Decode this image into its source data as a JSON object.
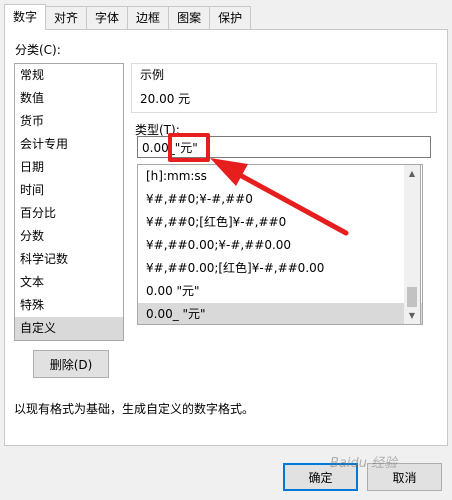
{
  "tabs": [
    {
      "label": "数字"
    },
    {
      "label": "对齐"
    },
    {
      "label": "字体"
    },
    {
      "label": "边框"
    },
    {
      "label": "图案"
    },
    {
      "label": "保护"
    }
  ],
  "category": {
    "label": "分类(C):",
    "items": [
      {
        "label": "常规"
      },
      {
        "label": "数值"
      },
      {
        "label": "货币"
      },
      {
        "label": "会计专用"
      },
      {
        "label": "日期"
      },
      {
        "label": "时间"
      },
      {
        "label": "百分比"
      },
      {
        "label": "分数"
      },
      {
        "label": "科学记数"
      },
      {
        "label": "文本"
      },
      {
        "label": "特殊"
      },
      {
        "label": "自定义"
      }
    ],
    "selected": "自定义"
  },
  "sample": {
    "label": "示例",
    "value": "20.00 元"
  },
  "type": {
    "label": "类型(T):",
    "value": "0.00_\"元\""
  },
  "formats": [
    {
      "label": "[h]:mm:ss"
    },
    {
      "label": "¥#,##0;¥-#,##0"
    },
    {
      "label": "¥#,##0;[红色]¥-#,##0"
    },
    {
      "label": "¥#,##0.00;¥-#,##0.00"
    },
    {
      "label": "¥#,##0.00;[红色]¥-#,##0.00"
    },
    {
      "label": "0.00 \"元\""
    },
    {
      "label": "0.00_ \"元\""
    }
  ],
  "delete_button": "删除(D)",
  "description": "以现有格式为基础，生成自定义的数字格式。",
  "ok_button": "确定",
  "cancel_button": "取消",
  "watermark": "Baidu 经验",
  "colors": {
    "annotation": "#e61e1e",
    "selection": "#d9d9d9",
    "accent": "#0078d7"
  }
}
